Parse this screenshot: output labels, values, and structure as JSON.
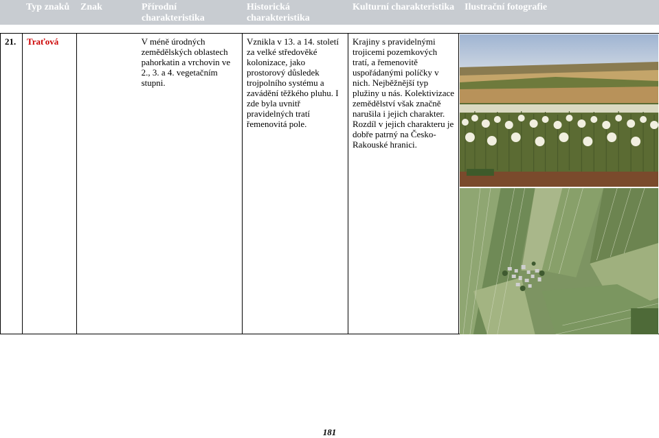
{
  "header": {
    "col_typ": "Typ znaků",
    "col_znak": "Znak",
    "col_prirodni_1": "Přírodní",
    "col_prirodni_2": "charakteristika",
    "col_historicka_1": "Historická",
    "col_historicka_2": "charakteristika",
    "col_kulturni": "Kulturní charakteristika",
    "col_foto": "Ilustrační fotografie"
  },
  "row": {
    "number": "21.",
    "znak": "Traťová",
    "prirodni": "V méně úrodných zemědělských oblastech pahorkatin a vrchovin ve 2., 3. a 4. vegetačním stupni.",
    "historicka": "Vznikla v 13. a 14. století za velké středověké kolonizace, jako prostorový důsledek trojpolního systému a zavádění těžkého pluhu. I zde byla uvnitř pravidelných tratí řemenovitá pole.",
    "kulturni": "Krajiny s pravidelnými trojicemi pozemkových tratí, a řemenovitě uspořádanými políčky v nich. Nejběžnější typ plužiny u nás. Kolektivizace zemědělství však značně narušila i jejich charakter. Rozdíl v jejich charakteru je dobře patrný na Česko-Rakouské hranici."
  },
  "photos": {
    "top": "field-photo",
    "bottom": "aerial-photo"
  },
  "colors": {
    "header_bg": "#c8ccd1",
    "znak_red": "#cc0000"
  },
  "page_number": "181"
}
